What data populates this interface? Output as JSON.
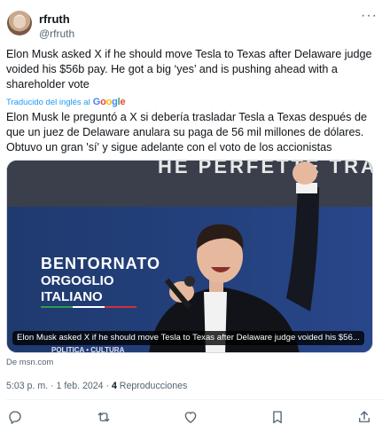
{
  "author": {
    "name": "rfruth",
    "handle": "@rfruth",
    "more_label": "···"
  },
  "tweet": {
    "text": "Elon Musk asked X if he should move Tesla to Texas after Delaware judge voided his $56b pay. He got a big ‘yes’ and is pushing ahead with a shareholder vote",
    "translated_by_label": "Traducido del inglés al",
    "translator_brand": "Google",
    "translated_text": "Elon Musk le preguntó a X si debería trasladar Tesla a Texas después de que un juez de Delaware anulara su paga de 56 mil millones de dólares. Obtuvo un gran 'sí' y sigue adelante con el voto de los accionistas"
  },
  "media": {
    "caption": "Elon Musk asked X if he should move Tesla to Texas after Delaware judge voided his $56...",
    "banner_top": "HE PERFETTE TRADIZIONI",
    "sign_line1": "BENTORNATO",
    "sign_line2": "ORGOGLIO",
    "sign_line3": "ITALIANO",
    "sign_bottom": "POLITICA • CULTURA"
  },
  "link_source": "De msn.com",
  "meta": {
    "time": "5:03 p. m. · 1 feb. 2024 · ",
    "views_count": "4",
    "views_label": " Reproducciones"
  },
  "colors": {
    "link_blue": "#1d9bf0",
    "secondary_text": "#536471",
    "google_blue": "#4285f4",
    "google_red": "#ea4335",
    "google_yellow": "#fbbc05",
    "google_green": "#34a853"
  },
  "icons": [
    "reply-icon",
    "retweet-icon",
    "like-icon",
    "bookmark-icon",
    "share-icon"
  ]
}
